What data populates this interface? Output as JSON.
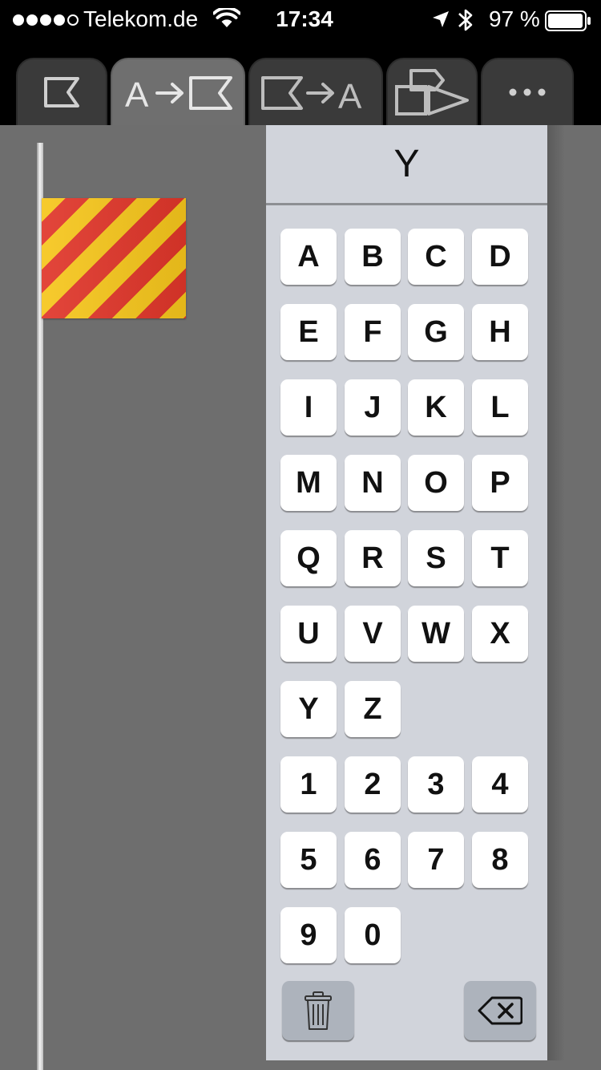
{
  "status_bar": {
    "carrier": "Telekom.de",
    "time": "17:34",
    "battery_percent": "97 %",
    "signal_bars_filled": 4,
    "signal_bars_total": 5,
    "battery_level": 0.97
  },
  "tabs": [
    {
      "name": "flag",
      "icon": "flag-icon",
      "active": false
    },
    {
      "name": "letter-to-flag",
      "icon": "letter-to-flag-icon",
      "active": true
    },
    {
      "name": "flag-to-letter",
      "icon": "flag-to-letter-icon",
      "active": false
    },
    {
      "name": "shapes",
      "icon": "shapes-icon",
      "active": false
    },
    {
      "name": "more",
      "icon": "more-icon",
      "active": false
    }
  ],
  "flag": {
    "letter": "Y",
    "colors": [
      "#f6c61c",
      "#e0362a"
    ]
  },
  "display": {
    "value": "Y"
  },
  "keyboard": {
    "letter_rows": [
      [
        "A",
        "B",
        "C",
        "D"
      ],
      [
        "E",
        "F",
        "G",
        "H"
      ],
      [
        "I",
        "J",
        "K",
        "L"
      ],
      [
        "M",
        "N",
        "O",
        "P"
      ],
      [
        "Q",
        "R",
        "S",
        "T"
      ],
      [
        "U",
        "V",
        "W",
        "X"
      ],
      [
        "Y",
        "Z"
      ]
    ],
    "digit_rows": [
      [
        "1",
        "2",
        "3",
        "4"
      ],
      [
        "5",
        "6",
        "7",
        "8"
      ],
      [
        "9",
        "0"
      ]
    ],
    "actions": [
      {
        "name": "clear",
        "icon": "trash-icon"
      },
      {
        "name": "backspace",
        "icon": "backspace-icon"
      }
    ]
  },
  "colors": {
    "panel_background": "#d1d4db",
    "key_background": "#ffffff",
    "action_key_background": "#adb3bc",
    "page_background": "#6e6e6e",
    "tab_background": "#3a3a3a",
    "tab_active_background": "#6f6f6f"
  }
}
